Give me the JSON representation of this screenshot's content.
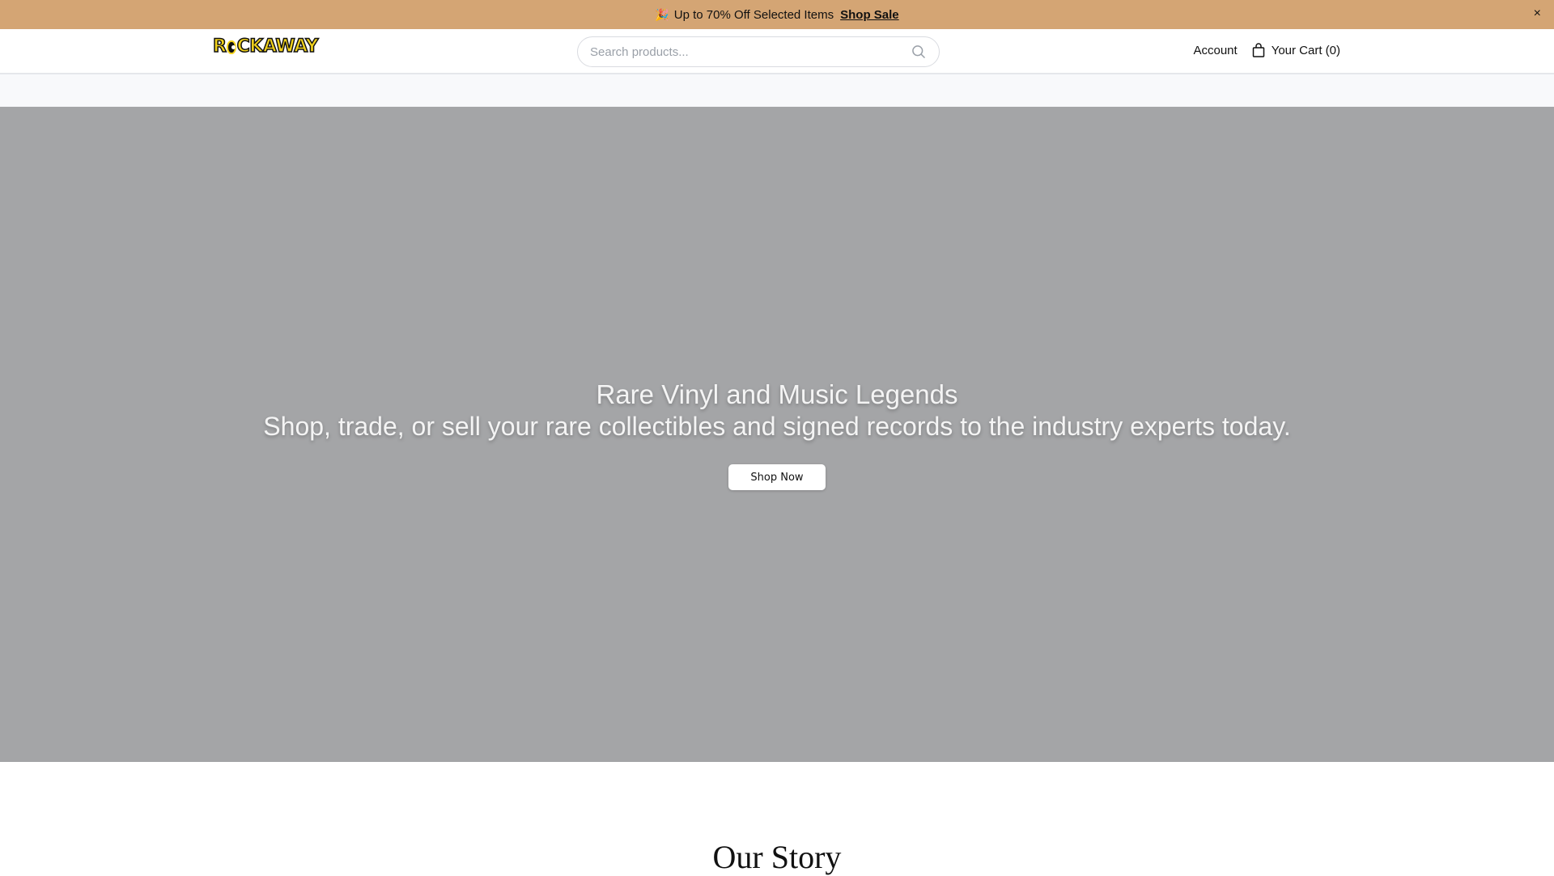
{
  "banner": {
    "emoji": "🎉",
    "text": "Up to 70% Off Selected Items",
    "link": "Shop Sale",
    "close": "×",
    "bg_color": "#d4a574"
  },
  "header": {
    "logo_pre": "R",
    "logo_post": "CKAWAY",
    "logo_text": "ROCKAWAY",
    "search_placeholder": "Search products...",
    "account": "Account",
    "cart": "Your Cart (0)"
  },
  "hero": {
    "title": "Rare Vinyl and Music Legends",
    "subtitle": "Shop, trade, or sell your rare collectibles and signed records to the industry experts today.",
    "cta": "Shop Now"
  },
  "story": {
    "title": "Our Story"
  }
}
